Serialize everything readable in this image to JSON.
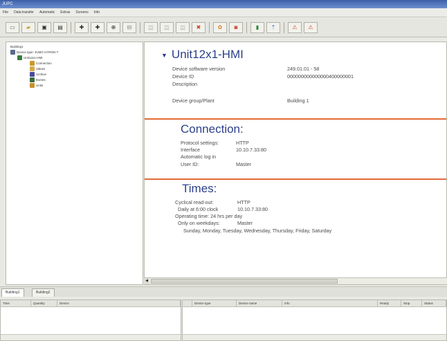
{
  "window": {
    "title": "JUPC"
  },
  "menu": [
    "File",
    "Data transfer",
    "Automatic",
    "Extras",
    "Screens",
    "Info"
  ],
  "toolbar": {
    "icons": [
      "new-icon",
      "open-icon",
      "save-icon",
      "print-icon",
      "move-up-icon",
      "move-down-icon",
      "connect-icon",
      "disconnect-icon",
      "copy-icon",
      "paste-icon",
      "delete-icon",
      "tools-icon",
      "chart-icon",
      "refresh-icon",
      "settings-icon",
      "up-icon",
      "warning-icon",
      "warning2-icon"
    ]
  },
  "tree": {
    "root": "Building1",
    "device_type": "Device type: JUMO mTRON T",
    "device": "Unit12x1-HMI",
    "children": [
      "Connection",
      "Values",
      "Archive",
      "Events",
      "Units"
    ]
  },
  "detail": {
    "device_name": "Unit12x1-HMI",
    "fields": [
      {
        "label": "Device software version",
        "value": "249.01.01 - 58"
      },
      {
        "label": "Device ID",
        "value": "000000000000000400000001"
      },
      {
        "label": "Description",
        "value": ""
      },
      {
        "label": "Device group/Plant",
        "value": "Building 1"
      }
    ],
    "connection": {
      "title": "Connection:",
      "fields": [
        {
          "label": "Protocol settings:",
          "value": "HTTP"
        },
        {
          "label": "Interface",
          "value": "10.10.7.33:80"
        },
        {
          "label": "Automatic log in",
          "value": ""
        },
        {
          "label": "User ID:",
          "value": "Master"
        }
      ]
    },
    "times": {
      "title": "Times:",
      "lines": [
        {
          "label": "Cyclical read-out:",
          "value": "HTTP"
        },
        {
          "label": "Daily at 6:00 clock",
          "value": "10.10.7.33:80"
        },
        {
          "label": "Operating time: 24 hrs per day",
          "value": ""
        },
        {
          "label": "Only on weekdays:",
          "value": "Master"
        },
        {
          "label": "Sunday, Monday, Tuesday, Wednesday, Thursday, Friday, Saturday",
          "value": ""
        }
      ]
    }
  },
  "tabs": [
    "Building1",
    "Building2"
  ],
  "bottom_left": {
    "columns": [
      "Time",
      "Quantity",
      "Device"
    ]
  },
  "bottom_right": {
    "columns": [
      "Device type",
      "Device name",
      "Info",
      "Ready",
      "Stop",
      "Status"
    ]
  }
}
